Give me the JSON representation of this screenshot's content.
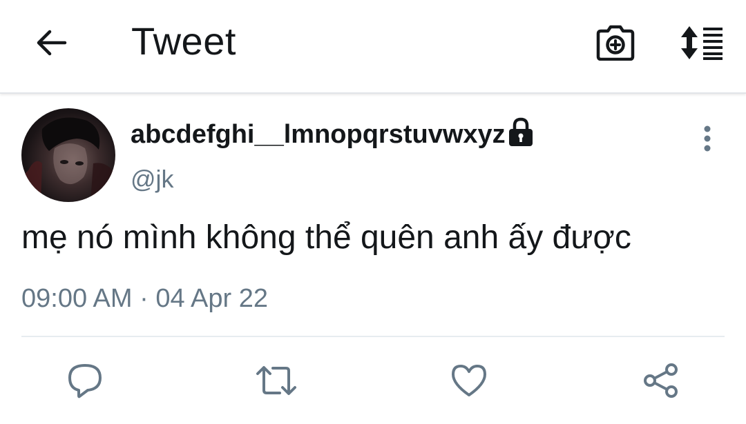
{
  "header": {
    "title": "Tweet",
    "back_icon": "arrow-left-icon",
    "camera_icon": "camera-plus-icon",
    "sort_icon": "sort-list-icon"
  },
  "tweet": {
    "display_name": "abcdefghi__lmnopqrstuvwxyz",
    "handle": "@jk",
    "protected": true,
    "text": "mẹ nó mình không thể quên anh ấy được",
    "timestamp": "09:00 AM · 04 Apr 22"
  },
  "actions": [
    {
      "name": "reply",
      "icon": "comment-icon"
    },
    {
      "name": "retweet",
      "icon": "retweet-icon"
    },
    {
      "name": "like",
      "icon": "heart-icon"
    },
    {
      "name": "share",
      "icon": "share-icon"
    }
  ],
  "colors": {
    "text_primary": "#14171a",
    "text_secondary": "#657786",
    "icon_accent": "#657786",
    "divider": "#e6ecf0"
  }
}
